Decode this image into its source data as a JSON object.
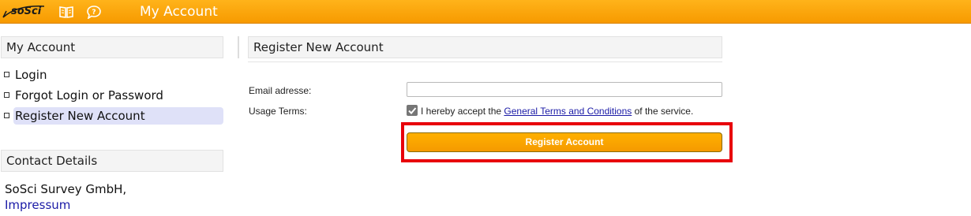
{
  "topbar": {
    "logo_text": "soSci",
    "icons": [
      "book-icon",
      "help-bubble-icon"
    ],
    "title": "My Account",
    "color": "#f79a00"
  },
  "sidebar": {
    "header": "My Account",
    "items": [
      {
        "label": "Login",
        "active": false
      },
      {
        "label": "Forgot Login or Password",
        "active": false
      },
      {
        "label": "Register New Account",
        "active": true
      }
    ],
    "contact_header": "Contact Details",
    "company": "SoSci Survey GmbH,",
    "impressum": "Impressum"
  },
  "main": {
    "header": "Register New Account",
    "email_label": "Email adresse:",
    "email_value": "",
    "terms_label": "Usage Terms:",
    "terms_checked": true,
    "terms_prefix": "I hereby accept the ",
    "terms_link": "General Terms and Conditions",
    "terms_suffix": " of the service.",
    "register_button": "Register Account"
  },
  "colors": {
    "accent": "#f79a00",
    "highlight": "#e8000b",
    "link": "#1a1aa6",
    "active_nav": "#dfe1f8"
  }
}
